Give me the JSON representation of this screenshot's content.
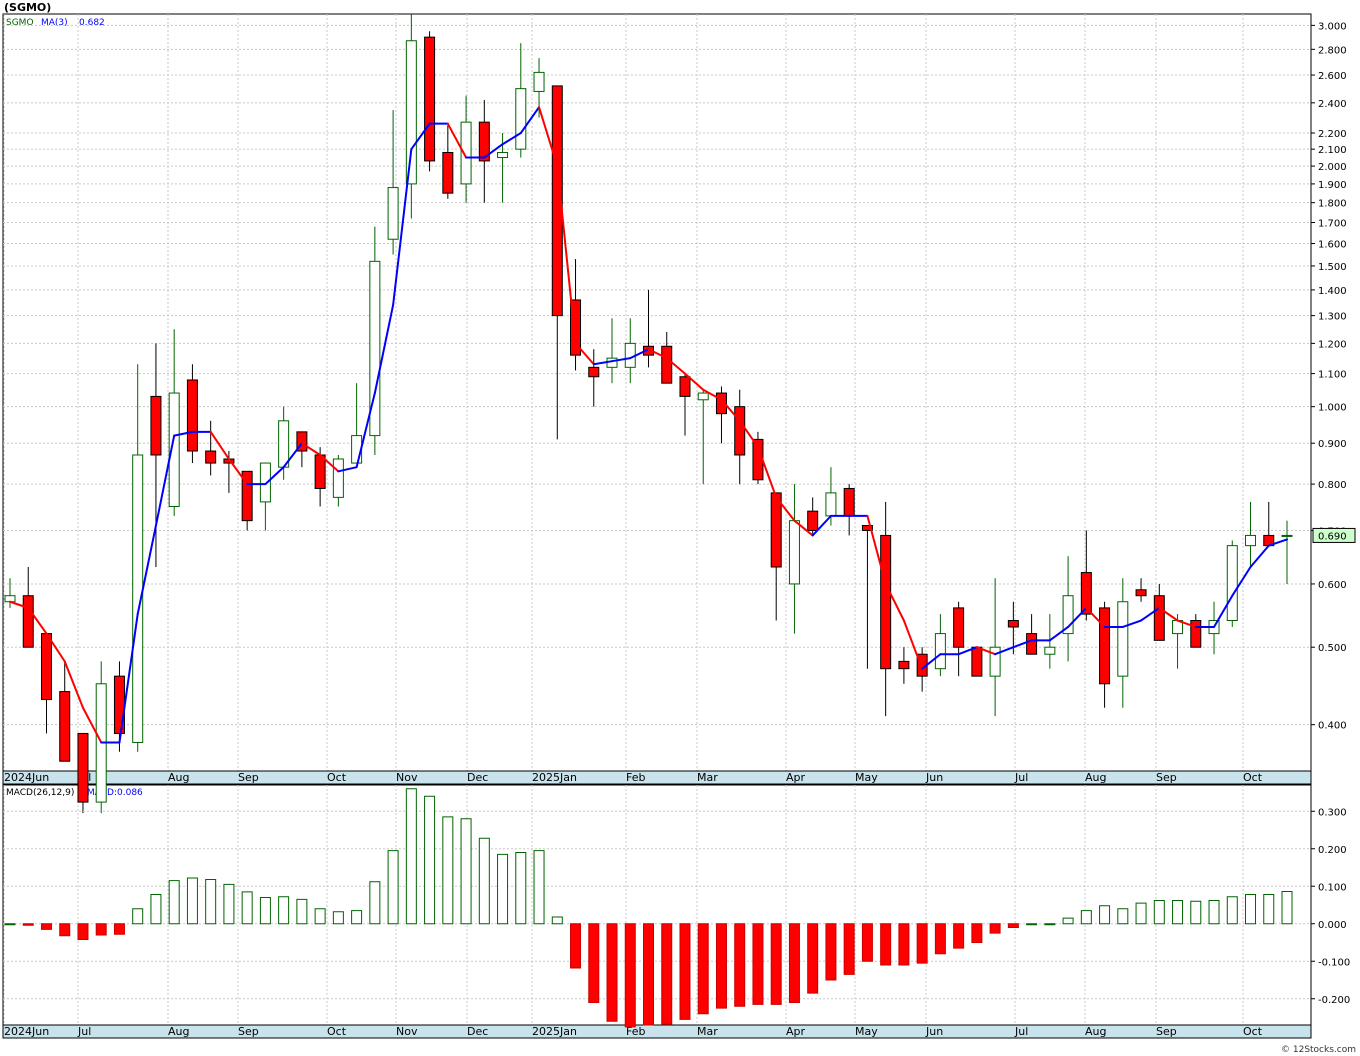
{
  "chart_data": [
    {
      "type": "candlestick",
      "title": "(SGMO)",
      "legend": [
        {
          "label": "SGMO",
          "color": "#006400"
        },
        {
          "label": "MA(3)",
          "color": "#0000ff"
        },
        {
          "label": "0.682",
          "color": "#0000ff"
        }
      ],
      "last_price_label": "0.690",
      "y_scale": "log",
      "ylim": [
        0.35,
        3.1
      ],
      "y_ticks": [
        "3.000",
        "2.800",
        "2.600",
        "2.400",
        "2.200",
        "2.100",
        "2.000",
        "1.900",
        "1.800",
        "1.700",
        "1.600",
        "1.500",
        "1.400",
        "1.300",
        "1.200",
        "1.100",
        "1.000",
        "0.900",
        "0.800",
        "0.700",
        "0.600",
        "0.500",
        "0.400"
      ],
      "x_labels": [
        "2024Jun",
        "Jul",
        "Aug",
        "Sep",
        "Oct",
        "Nov",
        "Dec",
        "2025Jan",
        "Feb",
        "Mar",
        "Apr",
        "May",
        "Jun",
        "Jul",
        "Aug",
        "Sep",
        "Oct"
      ],
      "candles": [
        {
          "o": 0.57,
          "h": 0.61,
          "l": 0.56,
          "c": 0.58
        },
        {
          "o": 0.58,
          "h": 0.63,
          "l": 0.5,
          "c": 0.5
        },
        {
          "o": 0.52,
          "h": 0.52,
          "l": 0.39,
          "c": 0.43
        },
        {
          "o": 0.44,
          "h": 0.48,
          "l": 0.36,
          "c": 0.36
        },
        {
          "o": 0.39,
          "h": 0.39,
          "l": 0.31,
          "c": 0.32
        },
        {
          "o": 0.32,
          "h": 0.48,
          "l": 0.31,
          "c": 0.45
        },
        {
          "o": 0.46,
          "h": 0.48,
          "l": 0.37,
          "c": 0.39
        },
        {
          "o": 0.38,
          "h": 1.13,
          "l": 0.37,
          "c": 0.87
        },
        {
          "o": 1.03,
          "h": 1.2,
          "l": 0.63,
          "c": 0.87
        },
        {
          "o": 0.75,
          "h": 1.25,
          "l": 0.73,
          "c": 1.04
        },
        {
          "o": 1.08,
          "h": 1.13,
          "l": 0.85,
          "c": 0.88
        },
        {
          "o": 0.88,
          "h": 0.96,
          "l": 0.82,
          "c": 0.85
        },
        {
          "o": 0.86,
          "h": 0.88,
          "l": 0.78,
          "c": 0.85
        },
        {
          "o": 0.83,
          "h": 0.83,
          "l": 0.7,
          "c": 0.72
        },
        {
          "o": 0.76,
          "h": 0.84,
          "l": 0.7,
          "c": 0.85
        },
        {
          "o": 0.84,
          "h": 1.0,
          "l": 0.81,
          "c": 0.96
        },
        {
          "o": 0.93,
          "h": 0.93,
          "l": 0.84,
          "c": 0.88
        },
        {
          "o": 0.87,
          "h": 0.89,
          "l": 0.75,
          "c": 0.79
        },
        {
          "o": 0.77,
          "h": 0.87,
          "l": 0.75,
          "c": 0.86
        },
        {
          "o": 0.85,
          "h": 1.07,
          "l": 0.85,
          "c": 0.92
        },
        {
          "o": 0.92,
          "h": 1.68,
          "l": 0.87,
          "c": 1.52
        },
        {
          "o": 1.62,
          "h": 2.35,
          "l": 1.55,
          "c": 1.88
        },
        {
          "o": 1.9,
          "h": 3.1,
          "l": 1.72,
          "c": 2.87
        },
        {
          "o": 2.9,
          "h": 2.95,
          "l": 1.97,
          "c": 2.03
        },
        {
          "o": 2.08,
          "h": 2.25,
          "l": 1.82,
          "c": 1.85
        },
        {
          "o": 1.9,
          "h": 2.45,
          "l": 1.8,
          "c": 2.27
        },
        {
          "o": 2.27,
          "h": 2.42,
          "l": 1.8,
          "c": 2.03
        },
        {
          "o": 2.05,
          "h": 2.2,
          "l": 1.8,
          "c": 2.08
        },
        {
          "o": 2.1,
          "h": 2.85,
          "l": 2.05,
          "c": 2.5
        },
        {
          "o": 2.48,
          "h": 2.73,
          "l": 2.3,
          "c": 2.62
        },
        {
          "o": 2.52,
          "h": 2.52,
          "l": 0.91,
          "c": 1.3
        },
        {
          "o": 1.36,
          "h": 1.53,
          "l": 1.11,
          "c": 1.16
        },
        {
          "o": 1.12,
          "h": 1.18,
          "l": 1.0,
          "c": 1.09
        },
        {
          "o": 1.12,
          "h": 1.29,
          "l": 1.07,
          "c": 1.15
        },
        {
          "o": 1.12,
          "h": 1.29,
          "l": 1.07,
          "c": 1.2
        },
        {
          "o": 1.19,
          "h": 1.4,
          "l": 1.12,
          "c": 1.16
        },
        {
          "o": 1.19,
          "h": 1.24,
          "l": 1.07,
          "c": 1.07
        },
        {
          "o": 1.09,
          "h": 1.1,
          "l": 0.92,
          "c": 1.03
        },
        {
          "o": 1.02,
          "h": 1.05,
          "l": 0.8,
          "c": 1.04
        },
        {
          "o": 1.04,
          "h": 1.06,
          "l": 0.9,
          "c": 0.98
        },
        {
          "o": 1.0,
          "h": 1.05,
          "l": 0.8,
          "c": 0.87
        },
        {
          "o": 0.91,
          "h": 0.93,
          "l": 0.8,
          "c": 0.81
        },
        {
          "o": 0.78,
          "h": 0.78,
          "l": 0.54,
          "c": 0.63
        },
        {
          "o": 0.6,
          "h": 0.8,
          "l": 0.52,
          "c": 0.72
        },
        {
          "o": 0.74,
          "h": 0.77,
          "l": 0.69,
          "c": 0.7
        },
        {
          "o": 0.73,
          "h": 0.84,
          "l": 0.71,
          "c": 0.78
        },
        {
          "o": 0.79,
          "h": 0.8,
          "l": 0.69,
          "c": 0.73
        },
        {
          "o": 0.71,
          "h": 0.71,
          "l": 0.47,
          "c": 0.7
        },
        {
          "o": 0.69,
          "h": 0.76,
          "l": 0.41,
          "c": 0.47
        },
        {
          "o": 0.48,
          "h": 0.5,
          "l": 0.45,
          "c": 0.47
        },
        {
          "o": 0.49,
          "h": 0.5,
          "l": 0.44,
          "c": 0.46
        },
        {
          "o": 0.47,
          "h": 0.55,
          "l": 0.46,
          "c": 0.52
        },
        {
          "o": 0.56,
          "h": 0.57,
          "l": 0.46,
          "c": 0.5
        },
        {
          "o": 0.5,
          "h": 0.5,
          "l": 0.46,
          "c": 0.46
        },
        {
          "o": 0.46,
          "h": 0.61,
          "l": 0.41,
          "c": 0.5
        },
        {
          "o": 0.54,
          "h": 0.57,
          "l": 0.49,
          "c": 0.53
        },
        {
          "o": 0.52,
          "h": 0.55,
          "l": 0.49,
          "c": 0.49
        },
        {
          "o": 0.49,
          "h": 0.55,
          "l": 0.47,
          "c": 0.5
        },
        {
          "o": 0.52,
          "h": 0.65,
          "l": 0.48,
          "c": 0.58
        },
        {
          "o": 0.62,
          "h": 0.7,
          "l": 0.54,
          "c": 0.55
        },
        {
          "o": 0.56,
          "h": 0.57,
          "l": 0.42,
          "c": 0.45
        },
        {
          "o": 0.46,
          "h": 0.61,
          "l": 0.42,
          "c": 0.57
        },
        {
          "o": 0.59,
          "h": 0.61,
          "l": 0.57,
          "c": 0.58
        },
        {
          "o": 0.58,
          "h": 0.6,
          "l": 0.51,
          "c": 0.51
        },
        {
          "o": 0.52,
          "h": 0.55,
          "l": 0.47,
          "c": 0.54
        },
        {
          "o": 0.54,
          "h": 0.55,
          "l": 0.5,
          "c": 0.5
        },
        {
          "o": 0.52,
          "h": 0.57,
          "l": 0.49,
          "c": 0.54
        },
        {
          "o": 0.54,
          "h": 0.68,
          "l": 0.53,
          "c": 0.67
        },
        {
          "o": 0.67,
          "h": 0.76,
          "l": 0.63,
          "c": 0.69
        },
        {
          "o": 0.69,
          "h": 0.76,
          "l": 0.67,
          "c": 0.67
        },
        {
          "o": 0.69,
          "h": 0.72,
          "l": 0.6,
          "c": 0.69
        }
      ],
      "ma": [
        0.57,
        0.56,
        0.52,
        0.48,
        0.42,
        0.38,
        0.38,
        0.55,
        0.71,
        0.92,
        0.93,
        0.93,
        0.86,
        0.8,
        0.8,
        0.84,
        0.9,
        0.87,
        0.83,
        0.84,
        1.04,
        1.34,
        2.1,
        2.26,
        2.26,
        2.05,
        2.05,
        2.13,
        2.2,
        2.37,
        2.0,
        1.2,
        1.13,
        1.14,
        1.15,
        1.18,
        1.15,
        1.1,
        1.05,
        1.02,
        0.96,
        0.89,
        0.77,
        0.72,
        0.69,
        0.73,
        0.73,
        0.73,
        0.6,
        0.54,
        0.47,
        0.49,
        0.49,
        0.5,
        0.49,
        0.5,
        0.51,
        0.51,
        0.53,
        0.56,
        0.53,
        0.53,
        0.54,
        0.56,
        0.54,
        0.53,
        0.53,
        0.58,
        0.63,
        0.67,
        0.682
      ]
    },
    {
      "type": "bar",
      "title": "MACD(26,12,9)",
      "legend_value_label": "MACD:0.086",
      "ylim": [
        -0.27,
        0.37
      ],
      "y_ticks": [
        "0.300",
        "0.200",
        "0.100",
        "0.000",
        "-0.100",
        "-0.200"
      ],
      "x_labels": [
        "2024Jun",
        "Jul",
        "Aug",
        "Sep",
        "Oct",
        "Nov",
        "Dec",
        "2025Jan",
        "Feb",
        "Mar",
        "Apr",
        "May",
        "Jun",
        "Jul",
        "Aug",
        "Sep",
        "Oct"
      ],
      "values": [
        0.0,
        -0.004,
        -0.015,
        -0.032,
        -0.042,
        -0.03,
        -0.028,
        0.04,
        0.078,
        0.115,
        0.122,
        0.118,
        0.105,
        0.085,
        0.07,
        0.072,
        0.065,
        0.04,
        0.032,
        0.035,
        0.112,
        0.195,
        0.36,
        0.34,
        0.285,
        0.28,
        0.228,
        0.185,
        0.19,
        0.195,
        0.018,
        -0.118,
        -0.21,
        -0.26,
        -0.275,
        -0.27,
        -0.268,
        -0.255,
        -0.24,
        -0.225,
        -0.22,
        -0.215,
        -0.215,
        -0.21,
        -0.185,
        -0.15,
        -0.135,
        -0.1,
        -0.11,
        -0.11,
        -0.105,
        -0.08,
        -0.065,
        -0.05,
        -0.025,
        -0.01,
        0.0,
        0.0,
        0.015,
        0.035,
        0.048,
        0.04,
        0.055,
        0.062,
        0.062,
        0.06,
        0.062,
        0.072,
        0.078,
        0.078,
        0.086
      ]
    }
  ],
  "footer": "© 12Stocks.com"
}
